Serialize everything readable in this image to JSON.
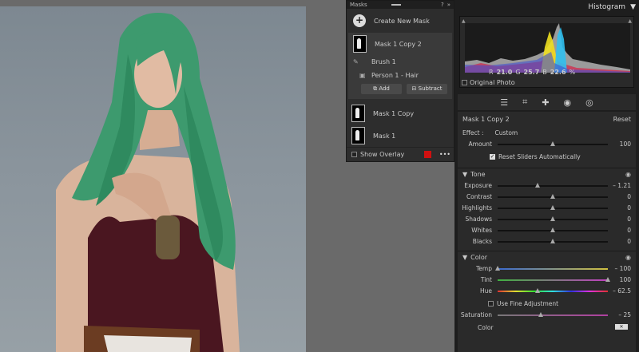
{
  "masks_panel": {
    "title": "Masks",
    "create_new_mask": "Create New Mask",
    "items": [
      {
        "label": "Mask 1 Copy 2"
      },
      {
        "label": "Mask 1 Copy"
      },
      {
        "label": "Mask 1"
      }
    ],
    "components": [
      {
        "label": "Brush 1"
      },
      {
        "label": "Person 1 - Hair"
      }
    ],
    "add_label": "Add",
    "subtract_label": "Subtract",
    "show_overlay": "Show Overlay",
    "overlay_color": "#d01010"
  },
  "histogram": {
    "title": "Histogram",
    "r_label": "R",
    "r_value": "21.0",
    "g_label": "G",
    "g_value": "25.7",
    "b_label": "B",
    "b_value": "22.6",
    "unit": "%",
    "original_photo": "Original Photo"
  },
  "mask_adjust": {
    "mask_name": "Mask 1 Copy 2",
    "reset": "Reset",
    "effect_label": "Effect :",
    "effect_value": "Custom",
    "amount_label": "Amount",
    "amount_value": "100",
    "amount_level": 0.5,
    "reset_sliders": "Reset Sliders Automatically"
  },
  "tone": {
    "title": "Tone",
    "sliders": [
      {
        "label": "Exposure",
        "value": "– 1.21",
        "level": 0.36
      },
      {
        "label": "Contrast",
        "value": "0",
        "level": 0.5
      },
      {
        "label": "Highlights",
        "value": "0",
        "level": 0.5
      },
      {
        "label": "Shadows",
        "value": "0",
        "level": 0.5
      },
      {
        "label": "Whites",
        "value": "0",
        "level": 0.5
      },
      {
        "label": "Blacks",
        "value": "0",
        "level": 0.5
      }
    ]
  },
  "color": {
    "title": "Color",
    "sliders": [
      {
        "label": "Temp",
        "value": "– 100",
        "level": 0.0
      },
      {
        "label": "Tint",
        "value": "100",
        "level": 1.0
      },
      {
        "label": "Hue",
        "value": "– 62.5",
        "level": 0.36
      }
    ],
    "fine_adjust": "Use Fine Adjustment",
    "saturation_label": "Saturation",
    "saturation_value": "– 25",
    "saturation_level": 0.39,
    "color_label": "Color"
  },
  "colors": {
    "hair": "#3d9a6e",
    "top": "#4a1620",
    "background": "#8b959d"
  }
}
